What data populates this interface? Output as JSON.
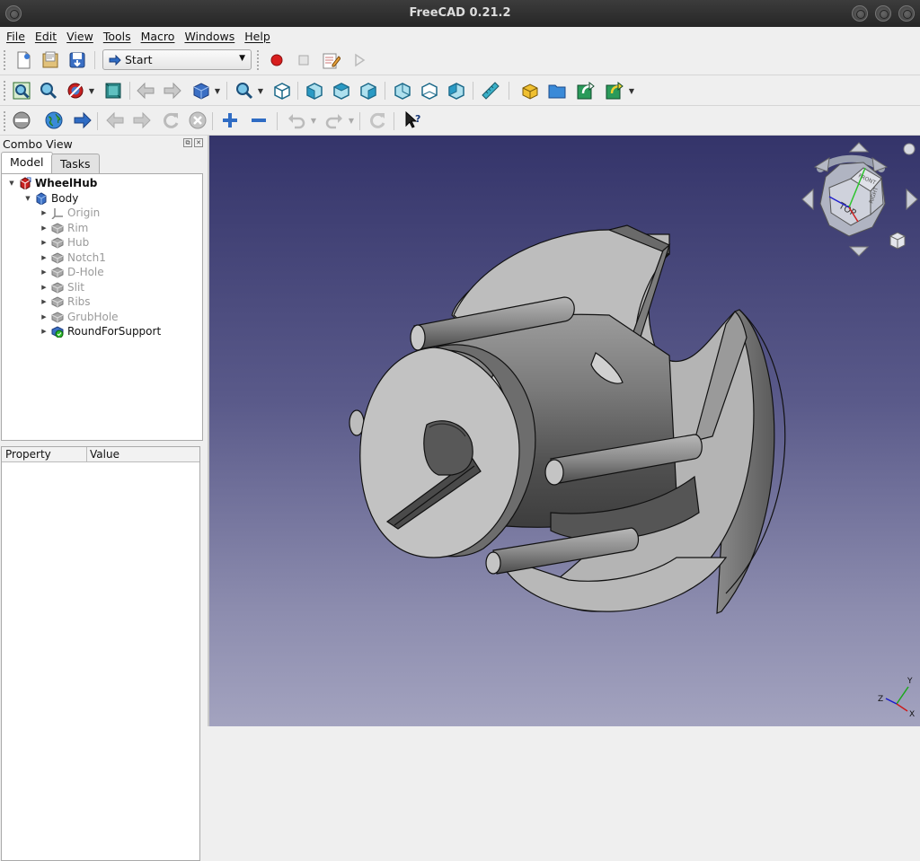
{
  "window": {
    "title": "FreeCAD 0.21.2"
  },
  "menu": [
    {
      "label": "File"
    },
    {
      "label": "Edit"
    },
    {
      "label": "View"
    },
    {
      "label": "Tools"
    },
    {
      "label": "Macro"
    },
    {
      "label": "Windows"
    },
    {
      "label": "Help"
    }
  ],
  "toolbar": {
    "workbench_selector": {
      "value": "Start"
    }
  },
  "combo_view": {
    "title": "Combo View",
    "tabs": [
      {
        "label": "Model"
      },
      {
        "label": "Tasks"
      }
    ],
    "active_tab": "Model",
    "tree": [
      {
        "label": "WheelHub",
        "icon": "document-icon",
        "level": 0,
        "expanded": true,
        "bold": true
      },
      {
        "label": "Body",
        "icon": "body-icon",
        "level": 1,
        "expanded": true
      },
      {
        "label": "Origin",
        "icon": "origin-icon",
        "level": 2,
        "dim": true
      },
      {
        "label": "Rim",
        "icon": "feature-icon",
        "level": 2,
        "dim": true
      },
      {
        "label": "Hub",
        "icon": "feature-icon",
        "level": 2,
        "dim": true
      },
      {
        "label": "Notch1",
        "icon": "feature-icon",
        "level": 2,
        "dim": true
      },
      {
        "label": "D-Hole",
        "icon": "feature-icon",
        "level": 2,
        "dim": true
      },
      {
        "label": "Slit",
        "icon": "feature-icon",
        "level": 2,
        "dim": true
      },
      {
        "label": "Ribs",
        "icon": "feature-icon",
        "level": 2,
        "dim": true
      },
      {
        "label": "GrubHole",
        "icon": "feature-icon",
        "level": 2,
        "dim": true
      },
      {
        "label": "RoundForSupport",
        "icon": "tip-feature-icon",
        "level": 2,
        "dim": false
      }
    ]
  },
  "property_view": {
    "columns": [
      {
        "label": "Property"
      },
      {
        "label": "Value"
      }
    ]
  },
  "viewport": {
    "navigation_cube": {
      "face_label": "TOP",
      "side_labels": [
        "FRONT",
        "RIGHT"
      ]
    },
    "axis_labels": [
      "Y",
      "Z",
      "X"
    ],
    "background_top": "#34346a",
    "background_bottom": "#a3a3bf"
  }
}
